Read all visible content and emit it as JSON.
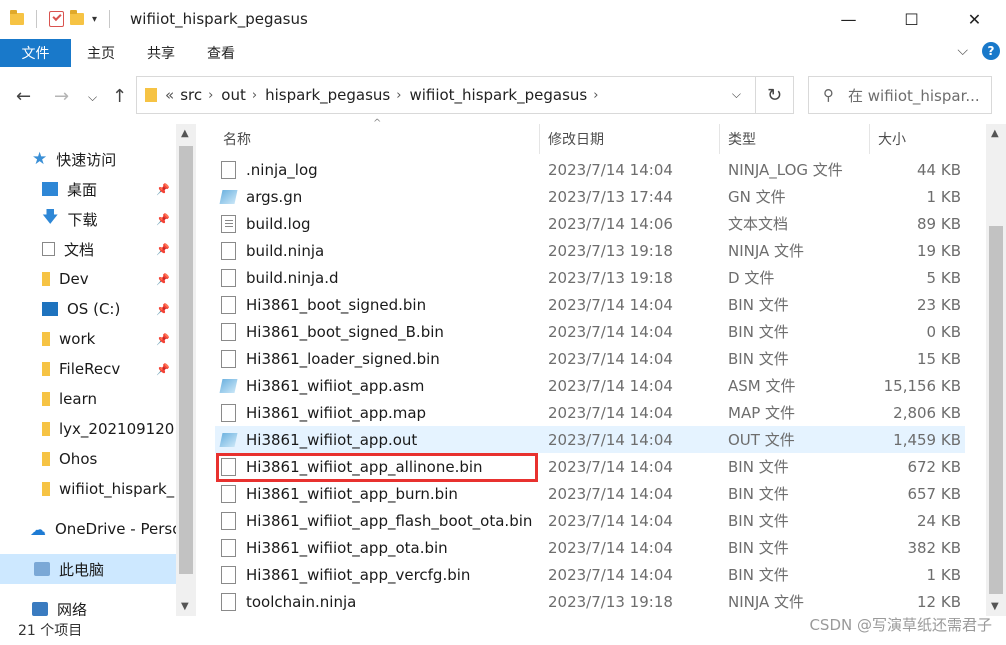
{
  "window": {
    "title": "wifiiot_hispark_pegasus",
    "minimize": "—",
    "maximize": "☐",
    "close": "✕"
  },
  "ribbon": {
    "file_tab": "文件",
    "tabs": [
      "主页",
      "共享",
      "查看"
    ],
    "expand": "⌵",
    "help": "?"
  },
  "address": {
    "back": "←",
    "forward": "→",
    "recent": "⌵",
    "up": "↑",
    "overflow": "«",
    "crumbs": [
      "src",
      "out",
      "hispark_pegasus",
      "wifiiot_hispark_pegasus"
    ],
    "dropdown": "⌵",
    "refresh": "↻",
    "search_placeholder": "在 wifiiot_hispar..."
  },
  "sidebar": {
    "items": [
      {
        "label": "快速访问",
        "icon": "star-icon",
        "pinned": false
      },
      {
        "label": "桌面",
        "icon": "desktop-icon",
        "pinned": true
      },
      {
        "label": "下载",
        "icon": "download-icon",
        "pinned": true
      },
      {
        "label": "文档",
        "icon": "document-icon",
        "pinned": true
      },
      {
        "label": "Dev",
        "icon": "folder-icon",
        "pinned": true
      },
      {
        "label": "OS (C:)",
        "icon": "drive-icon",
        "pinned": true
      },
      {
        "label": "work",
        "icon": "folder-icon",
        "pinned": true
      },
      {
        "label": "FileRecv",
        "icon": "folder-icon",
        "pinned": true
      },
      {
        "label": "learn",
        "icon": "folder-icon",
        "pinned": false
      },
      {
        "label": "lyx_202109120",
        "icon": "folder-icon",
        "pinned": false
      },
      {
        "label": "Ohos",
        "icon": "folder-icon",
        "pinned": false
      },
      {
        "label": "wifiiot_hispark_",
        "icon": "folder-icon",
        "pinned": false
      },
      {
        "label": "OneDrive - Perso",
        "icon": "cloud-icon",
        "pinned": false
      },
      {
        "label": "此电脑",
        "icon": "computer-icon",
        "pinned": false
      },
      {
        "label": "网络",
        "icon": "network-icon",
        "pinned": false
      }
    ],
    "pin_glyph": "📌"
  },
  "columns": {
    "name": "名称",
    "date": "修改日期",
    "type": "类型",
    "size": "大小"
  },
  "files": [
    {
      "name": ".ninja_log",
      "date": "2023/7/14 14:04",
      "type": "NINJA_LOG 文件",
      "size": "44 KB",
      "icon": "file-icon"
    },
    {
      "name": "args.gn",
      "date": "2023/7/13 17:44",
      "type": "GN 文件",
      "size": "1 KB",
      "icon": "script-file-icon"
    },
    {
      "name": "build.log",
      "date": "2023/7/14 14:06",
      "type": "文本文档",
      "size": "89 KB",
      "icon": "text-file-icon"
    },
    {
      "name": "build.ninja",
      "date": "2023/7/13 19:18",
      "type": "NINJA 文件",
      "size": "19 KB",
      "icon": "file-icon"
    },
    {
      "name": "build.ninja.d",
      "date": "2023/7/13 19:18",
      "type": "D 文件",
      "size": "5 KB",
      "icon": "file-icon"
    },
    {
      "name": "Hi3861_boot_signed.bin",
      "date": "2023/7/14 14:04",
      "type": "BIN 文件",
      "size": "23 KB",
      "icon": "file-icon"
    },
    {
      "name": "Hi3861_boot_signed_B.bin",
      "date": "2023/7/14 14:04",
      "type": "BIN 文件",
      "size": "0 KB",
      "icon": "file-icon"
    },
    {
      "name": "Hi3861_loader_signed.bin",
      "date": "2023/7/14 14:04",
      "type": "BIN 文件",
      "size": "15 KB",
      "icon": "file-icon"
    },
    {
      "name": "Hi3861_wifiiot_app.asm",
      "date": "2023/7/14 14:04",
      "type": "ASM 文件",
      "size": "15,156 KB",
      "icon": "script-file-icon"
    },
    {
      "name": "Hi3861_wifiiot_app.map",
      "date": "2023/7/14 14:04",
      "type": "MAP 文件",
      "size": "2,806 KB",
      "icon": "file-icon"
    },
    {
      "name": "Hi3861_wifiiot_app.out",
      "date": "2023/7/14 14:04",
      "type": "OUT 文件",
      "size": "1,459 KB",
      "icon": "script-file-icon"
    },
    {
      "name": "Hi3861_wifiiot_app_allinone.bin",
      "date": "2023/7/14 14:04",
      "type": "BIN 文件",
      "size": "672 KB",
      "icon": "file-icon"
    },
    {
      "name": "Hi3861_wifiiot_app_burn.bin",
      "date": "2023/7/14 14:04",
      "type": "BIN 文件",
      "size": "657 KB",
      "icon": "file-icon"
    },
    {
      "name": "Hi3861_wifiiot_app_flash_boot_ota.bin",
      "date": "2023/7/14 14:04",
      "type": "BIN 文件",
      "size": "24 KB",
      "icon": "file-icon"
    },
    {
      "name": "Hi3861_wifiiot_app_ota.bin",
      "date": "2023/7/14 14:04",
      "type": "BIN 文件",
      "size": "382 KB",
      "icon": "file-icon"
    },
    {
      "name": "Hi3861_wifiiot_app_vercfg.bin",
      "date": "2023/7/14 14:04",
      "type": "BIN 文件",
      "size": "1 KB",
      "icon": "file-icon"
    },
    {
      "name": "toolchain.ninja",
      "date": "2023/7/13 19:18",
      "type": "NINJA 文件",
      "size": "12 KB",
      "icon": "file-icon"
    }
  ],
  "hovered_row": "Hi3861_wifiiot_app.out",
  "highlighted_row": "Hi3861_wifiiot_app_allinone.bin",
  "highlight_color": "#e8312f",
  "status": {
    "count": "21 个项目"
  },
  "watermark": "CSDN @写演草纸还需君子"
}
